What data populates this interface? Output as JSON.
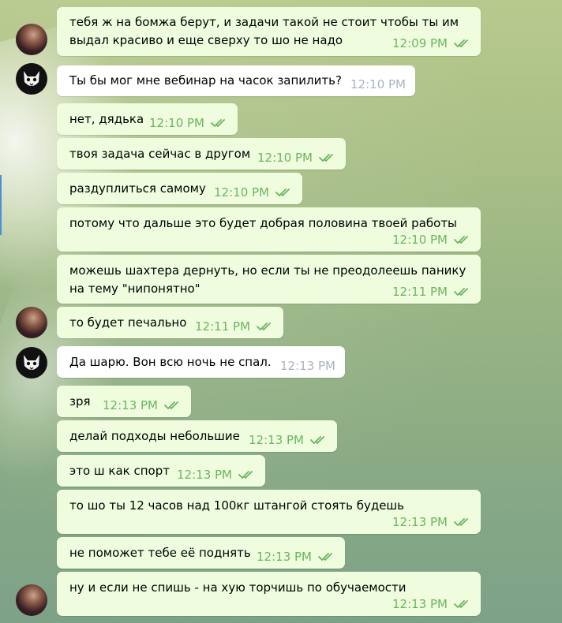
{
  "colors": {
    "out_bubble": "#effdde",
    "in_bubble": "#ffffff",
    "out_time": "#6bb55f",
    "in_time": "#aab3bd",
    "accent": "#4a8fd6"
  },
  "messages": [
    {
      "dir": "out",
      "lines": [
        "тебя ж на бомжа берут, и задачи такой не стоит чтобы ты им",
        "выдал красиво и еще сверху то шо не надо"
      ],
      "time": "12:09 PM",
      "read": true
    },
    {
      "dir": "in",
      "lines": [
        "Ты бы мог мне вебинар на часок запилить?"
      ],
      "time": "12:10 PM"
    },
    {
      "dir": "out",
      "lines": [
        "нет, дядька"
      ],
      "time": "12:10 PM",
      "read": true
    },
    {
      "dir": "out",
      "lines": [
        "твоя задача сейчас в другом"
      ],
      "time": "12:10 PM",
      "read": true
    },
    {
      "dir": "out",
      "lines": [
        "раздуплиться самому"
      ],
      "time": "12:10 PM",
      "read": true
    },
    {
      "dir": "out",
      "lines": [
        "потому что дальше это будет добрая половина твоей работы"
      ],
      "time": "12:10 PM",
      "read": true
    },
    {
      "dir": "out",
      "lines": [
        "можешь шахтера дернуть, но если ты не преодолеешь панику",
        "на тему \"нипонятно\""
      ],
      "time": "12:11 PM",
      "read": true
    },
    {
      "dir": "out",
      "lines": [
        "то будет печально"
      ],
      "time": "12:11 PM",
      "read": true
    },
    {
      "dir": "in",
      "lines": [
        "Да шарю. Вон всю ночь не спал."
      ],
      "time": "12:13 PM"
    },
    {
      "dir": "out",
      "lines": [
        "зря"
      ],
      "time": "12:13 PM",
      "read": true
    },
    {
      "dir": "out",
      "lines": [
        "делай подходы небольшие"
      ],
      "time": "12:13 PM",
      "read": true
    },
    {
      "dir": "out",
      "lines": [
        "это ш как спорт"
      ],
      "time": "12:13 PM",
      "read": true
    },
    {
      "dir": "out",
      "lines": [
        "то шо ты 12 часов над 100кг штангой стоять будешь"
      ],
      "time": "12:13 PM",
      "read": true
    },
    {
      "dir": "out",
      "lines": [
        "не поможет тебе её поднять"
      ],
      "time": "12:13 PM",
      "read": true
    },
    {
      "dir": "out",
      "lines": [
        "ну и если не спишь - на хую торчишь по обучаемости"
      ],
      "time": "12:13 PM",
      "read": true
    }
  ]
}
